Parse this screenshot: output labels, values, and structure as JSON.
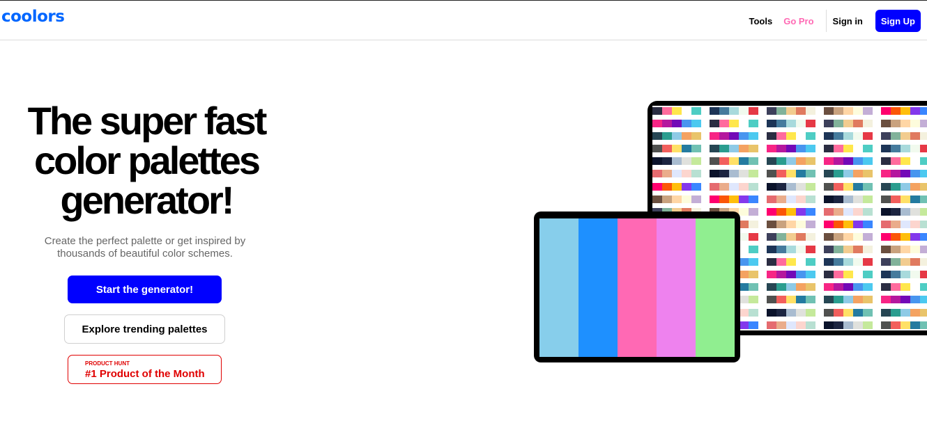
{
  "header": {
    "logo": "coolors",
    "nav": {
      "tools": "Tools",
      "go_pro": "Go Pro",
      "sign_in": "Sign in",
      "sign_up": "Sign Up"
    }
  },
  "hero": {
    "title_line1": "The super fast",
    "title_line2": "color palettes",
    "title_line3": "generator!",
    "subtitle_line1": "Create the perfect palette or get inspired by",
    "subtitle_line2": "thousands of beautiful color schemes.",
    "start_button": "Start the generator!",
    "explore_button": "Explore trending palettes",
    "product_hunt": {
      "label": "PRODUCT HUNT",
      "award": "#1 Product of the Month"
    }
  },
  "colors": {
    "brand_blue": "#0066ff",
    "cta_blue": "#0000ff",
    "go_pro_pink": "#ff69b4",
    "product_hunt_red": "#e00000"
  },
  "featured_palette": [
    "#87CEEB",
    "#1E90FF",
    "#FF69B4",
    "#EE82EE",
    "#90EE90"
  ],
  "palette_grid": [
    [
      "#2b2d42",
      "#ff6b9d",
      "#ffe74c",
      "#ffffff",
      "#4ecdc4"
    ],
    [
      "#6b4f3f",
      "#c9a27e",
      "#ffd6a5",
      "#fdfcdc",
      "#c3aed6"
    ],
    [
      "#0b132b",
      "#1c2541",
      "#a9bcd0",
      "#e0e1dd",
      "#c5e99b"
    ],
    [
      "#f72585",
      "#b5179e",
      "#7209b7",
      "#4895ef",
      "#4cc9f0"
    ],
    [
      "#3d405b",
      "#81b29a",
      "#f2cc8f",
      "#e07a5f",
      "#f4f1de"
    ],
    [
      "#e56b6f",
      "#eaac8b",
      "#dfe7fd",
      "#fcd5ce",
      "#b8e0d2"
    ],
    [
      "#264653",
      "#2a9d8f",
      "#8ecae6",
      "#f4a261",
      "#e9c46a"
    ],
    [
      "#1d3557",
      "#457b9d",
      "#a8dadc",
      "#f1faee",
      "#e63946"
    ],
    [
      "#ff006e",
      "#fb5607",
      "#ffbe0b",
      "#8338ec",
      "#3a86ff"
    ],
    [
      "#50514f",
      "#f25f5c",
      "#ffe066",
      "#247ba0",
      "#70c1b3"
    ]
  ]
}
